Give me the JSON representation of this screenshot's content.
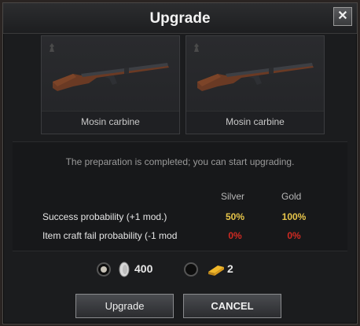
{
  "dialog": {
    "title": "Upgrade",
    "close_symbol": "✕"
  },
  "items": [
    {
      "name": "Mosin carbine",
      "icon": "rifle-icon"
    },
    {
      "name": "Mosin carbine",
      "icon": "rifle-icon"
    }
  ],
  "info": {
    "message": "The preparation is completed; you can start upgrading.",
    "columns": [
      "Silver",
      "Gold"
    ],
    "rows": [
      {
        "label": "Success probability (+1 mod.)",
        "silver": "50%",
        "gold": "100%"
      },
      {
        "label": "Item craft fail probability (-1 mod.)",
        "silver": "0%",
        "gold": "0%"
      }
    ]
  },
  "currency": {
    "silver_amount": "400",
    "gold_amount": "2",
    "selected": "silver"
  },
  "buttons": {
    "upgrade": "Upgrade",
    "cancel": "CANCEL"
  },
  "colors": {
    "yellow": "#e7c54a",
    "red": "#d12a22"
  }
}
